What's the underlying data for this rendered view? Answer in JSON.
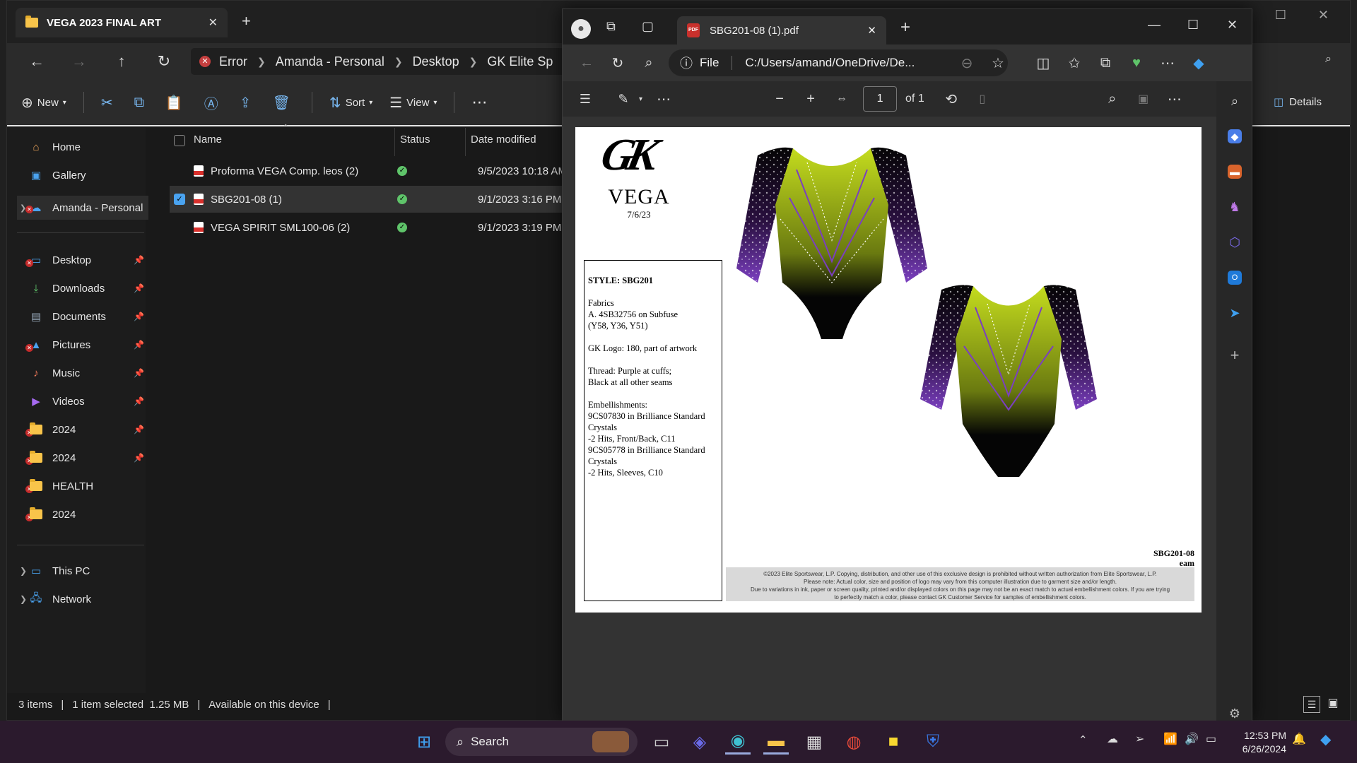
{
  "explorer": {
    "tab_title": "VEGA 2023 FINAL ART",
    "breadcrumb": [
      "Error",
      "Amanda - Personal",
      "Desktop",
      "GK Elite Sp"
    ],
    "toolbar": {
      "new_label": "New",
      "sort_label": "Sort",
      "view_label": "View",
      "details_label": "Details"
    },
    "sidebar": {
      "home": "Home",
      "gallery": "Gallery",
      "onedrive": "Amanda - Personal",
      "pinned": [
        "Desktop",
        "Downloads",
        "Documents",
        "Pictures",
        "Music",
        "Videos",
        "2024",
        "2024",
        "HEALTH",
        "2024"
      ],
      "this_pc": "This PC",
      "network": "Network"
    },
    "columns": {
      "name": "Name",
      "status": "Status",
      "date": "Date modified"
    },
    "files": [
      {
        "name": "Proforma VEGA Comp. leos (2)",
        "date": "9/5/2023 10:18 AM",
        "selected": false
      },
      {
        "name": "SBG201-08 (1)",
        "date": "9/1/2023 3:16 PM",
        "selected": true
      },
      {
        "name": "VEGA SPIRIT SML100-06 (2)",
        "date": "9/1/2023 3:19 PM",
        "selected": false
      }
    ],
    "status": {
      "items": "3 items",
      "selected": "1 item selected  1.25 MB",
      "availability": "Available on this device"
    }
  },
  "edge": {
    "tab_title": "SBG201-08 (1).pdf",
    "url_scheme": "File",
    "url": "C:/Users/amand/OneDrive/De...",
    "page_current": "1",
    "page_total": "of 1"
  },
  "pdf": {
    "brand_logo": "GK",
    "collection": "VEGA",
    "date": "7/6/23",
    "spec_title": "STYLE: SBG201",
    "spec_body": "Fabrics\nA. 4SB32756 on Subfuse\n   (Y58, Y36, Y51)\n\nGK Logo: 180, part of artwork\n\nThread:  Purple at cuffs;\nBlack at all other seams\n\nEmbellishments:\n9CS07830 in Brilliance Standard\n   Crystals\n    -2 Hits, Front/Back, C11\n9CS05778 in Brilliance Standard\n   Crystals\n   -2 Hits, Sleeves, C10",
    "style_code": "SBG201-08",
    "initials": "eam",
    "legal": [
      "©2023 Elite Sportswear, L.P. Copying, distribution, and other use of this exclusive design is prohibited without written authorization from Elite Sportswear, L.P.",
      "Please note: Actual color, size and position of logo may vary from this computer illustration due to garment size and/or length.",
      "Due to variations in ink, paper or screen quality, printed and/or displayed colors on this page may not be an exact match to actual embellishment colors.  If you are trying",
      "to perfectly match a color, please contact GK Customer Service for samples of embellishment colors."
    ],
    "colors": {
      "lime": "#c4dc1e",
      "purple": "#7b3fc0",
      "black": "#050505"
    }
  },
  "taskbar": {
    "search": "Search",
    "time": "12:53 PM",
    "date": "6/26/2024"
  }
}
